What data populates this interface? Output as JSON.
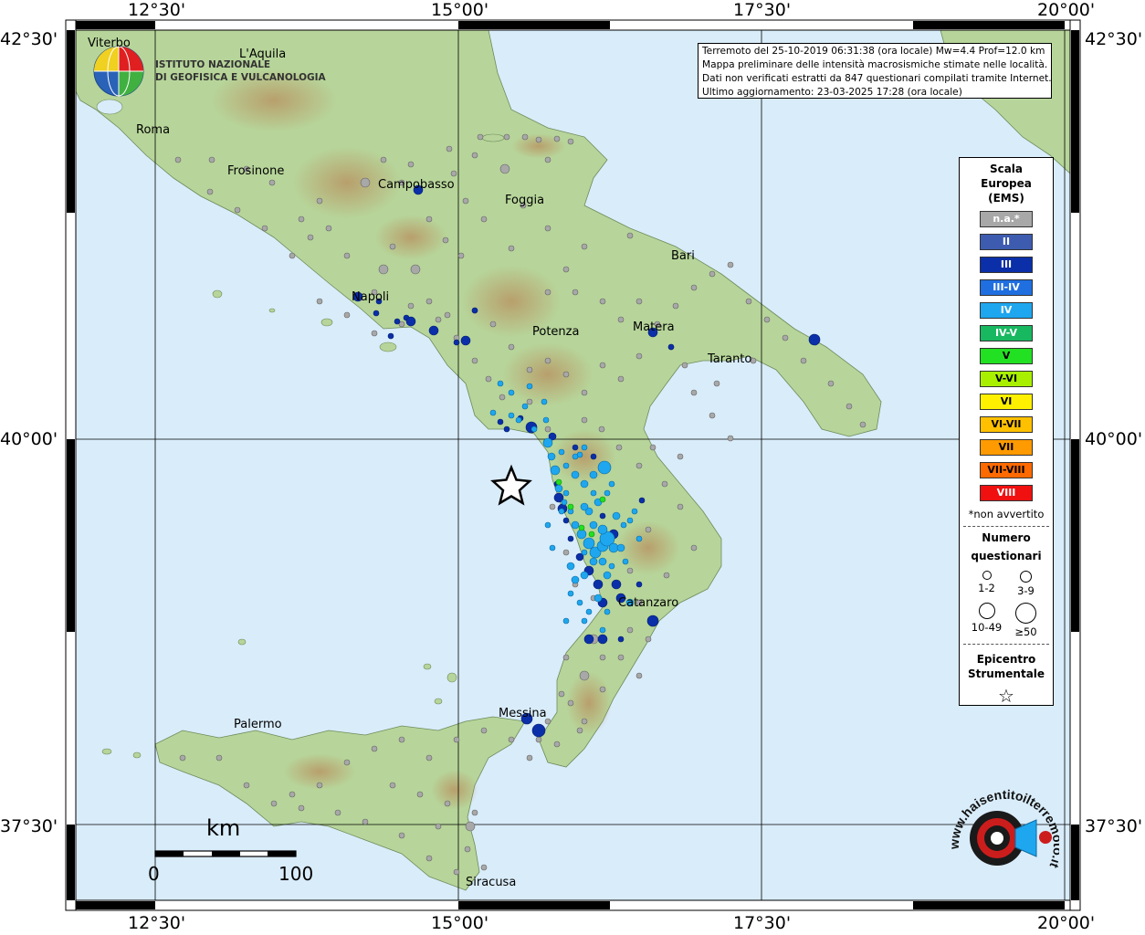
{
  "coords": {
    "top": [
      "12°30'",
      "15°00'",
      "17°30'",
      "20°00'"
    ],
    "bottom": [
      "12°30'",
      "15°00'",
      "17°30'",
      "20°00'"
    ],
    "left": [
      "42°30'",
      "40°00'",
      "37°30'"
    ],
    "right": [
      "42°30'",
      "40°00'",
      "37°30'"
    ]
  },
  "info": {
    "line1": "Terremoto del 25-10-2019 06:31:38 (ora locale) Mw=4.4 Prof=12.0 km",
    "line2": "Mappa preliminare delle intensità macrosismiche stimate nelle località.",
    "line3": "Dati non verificati estratti da 847 questionari compilati tramite Internet.",
    "line4": "Ultimo aggiornamento: 23-03-2025 17:28 (ora locale)"
  },
  "logo": {
    "line1": "ISTITUTO NAZIONALE",
    "line2": "DI GEOFISICA E VULCANOLOGIA"
  },
  "legend": {
    "title1": "Scala",
    "title2": "Europea",
    "title3": "(EMS)",
    "scale": [
      {
        "label": "n.a.*",
        "color": "#a8a8a8",
        "text": "#ffffff"
      },
      {
        "label": "II",
        "color": "#3d5cb0",
        "text": "#ffffff"
      },
      {
        "label": "III",
        "color": "#0a2fa8",
        "text": "#ffffff"
      },
      {
        "label": "III-IV",
        "color": "#1f6fe0",
        "text": "#ffffff"
      },
      {
        "label": "IV",
        "color": "#1ea7ef",
        "text": "#ffffff"
      },
      {
        "label": "IV-V",
        "color": "#18b860",
        "text": "#ffffff"
      },
      {
        "label": "V",
        "color": "#22e022",
        "text": "#000000"
      },
      {
        "label": "V-VI",
        "color": "#a8f000",
        "text": "#000000"
      },
      {
        "label": "VI",
        "color": "#fff000",
        "text": "#000000"
      },
      {
        "label": "VI-VII",
        "color": "#ffc000",
        "text": "#000000"
      },
      {
        "label": "VII",
        "color": "#ff9a00",
        "text": "#000000"
      },
      {
        "label": "VII-VIII",
        "color": "#ff6a00",
        "text": "#000000"
      },
      {
        "label": "VIII",
        "color": "#f01010",
        "text": "#ffffff"
      }
    ],
    "note": "*non avvertito",
    "q_title1": "Numero",
    "q_title2": "questionari",
    "q_sizes": [
      {
        "label": "1-2",
        "size": 8
      },
      {
        "label": "3-9",
        "size": 11
      },
      {
        "label": "10-49",
        "size": 16
      },
      {
        "label": "≥50",
        "size": 21
      }
    ],
    "epi_title1": "Epicentro",
    "epi_title2": "Strumentale",
    "epi_symbol": "☆"
  },
  "cities": [
    {
      "name": "Viterbo"
    },
    {
      "name": "L'Aquila"
    },
    {
      "name": "Roma"
    },
    {
      "name": "Frosinone"
    },
    {
      "name": "Campobasso"
    },
    {
      "name": "Foggia"
    },
    {
      "name": "Bari"
    },
    {
      "name": "Napoli"
    },
    {
      "name": "Potenza"
    },
    {
      "name": "Matera"
    },
    {
      "name": "Taranto"
    },
    {
      "name": "Catanzaro"
    },
    {
      "name": "Messina"
    },
    {
      "name": "Palermo"
    },
    {
      "name": "Siracusa"
    }
  ],
  "scalebar": {
    "title": "km",
    "start": "0",
    "end": "100"
  },
  "brand": {
    "text": "www.haisentitoilterremoto.it"
  },
  "colors": {
    "sea": "#d9ecfa",
    "land": "#b7d59a",
    "mountain": "#c9a77a",
    "grid": "#000000",
    "na": "#a8a8a8",
    "iii": "#0a2fa8",
    "iv": "#1ea7ef",
    "v": "#22e022"
  }
}
